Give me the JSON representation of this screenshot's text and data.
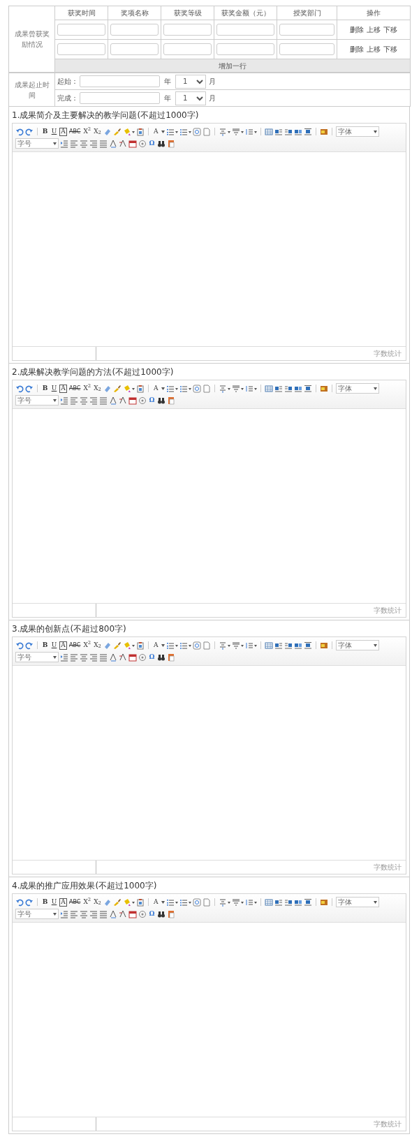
{
  "awards": {
    "label": "成果曾获奖励情况",
    "columns": [
      "获奖时间",
      "奖项名称",
      "获奖等级",
      "获奖金额（元）",
      "授奖部门",
      "操作"
    ],
    "rows": [
      {
        "actions": [
          "删除",
          "上移",
          "下移"
        ]
      },
      {
        "actions": [
          "删除",
          "上移",
          "下移"
        ]
      }
    ],
    "add_row": "增加一行"
  },
  "period": {
    "label": "成果起止时间",
    "rows": [
      {
        "label": "起始：",
        "year_unit": "年",
        "month": "1",
        "month_unit": "月"
      },
      {
        "label": "完成：",
        "year_unit": "年",
        "month": "1",
        "month_unit": "月"
      }
    ]
  },
  "editors": [
    {
      "title": "1.成果简介及主要解决的教学问题(不超过1000字)",
      "glyphs": [
        "B",
        "U",
        "A",
        "ABC",
        "X$^{2}$",
        "X$_{2}$",
        "A",
        "Ω"
      ],
      "font": "字体",
      "size": "字号",
      "word_count": "字数统计"
    },
    {
      "title": "2.成果解决教学问题的方法(不超过1000字)",
      "glyphs": [
        "B",
        "U",
        "A",
        "ABC",
        "X$^{2}$",
        "X$_{2}$",
        "A",
        "Ω"
      ],
      "font": "字体",
      "size": "字号",
      "word_count": "字数统计"
    },
    {
      "title": "3.成果的创新点(不超过800字)",
      "glyphs": [
        "B",
        "U",
        "A",
        "ABC",
        "X$^{2}$",
        "X$_{2}$",
        "A",
        "Ω"
      ],
      "font": "字体",
      "size": "字号",
      "word_count": "字数统计"
    },
    {
      "title": "4.成果的推广应用效果(不超过1000字)",
      "glyphs": [
        "B",
        "U",
        "A",
        "ABC",
        "X$^{2}$",
        "X$_{2}$",
        "A",
        "Ω"
      ],
      "font": "字体",
      "size": "字号",
      "word_count": "字数统计"
    }
  ]
}
